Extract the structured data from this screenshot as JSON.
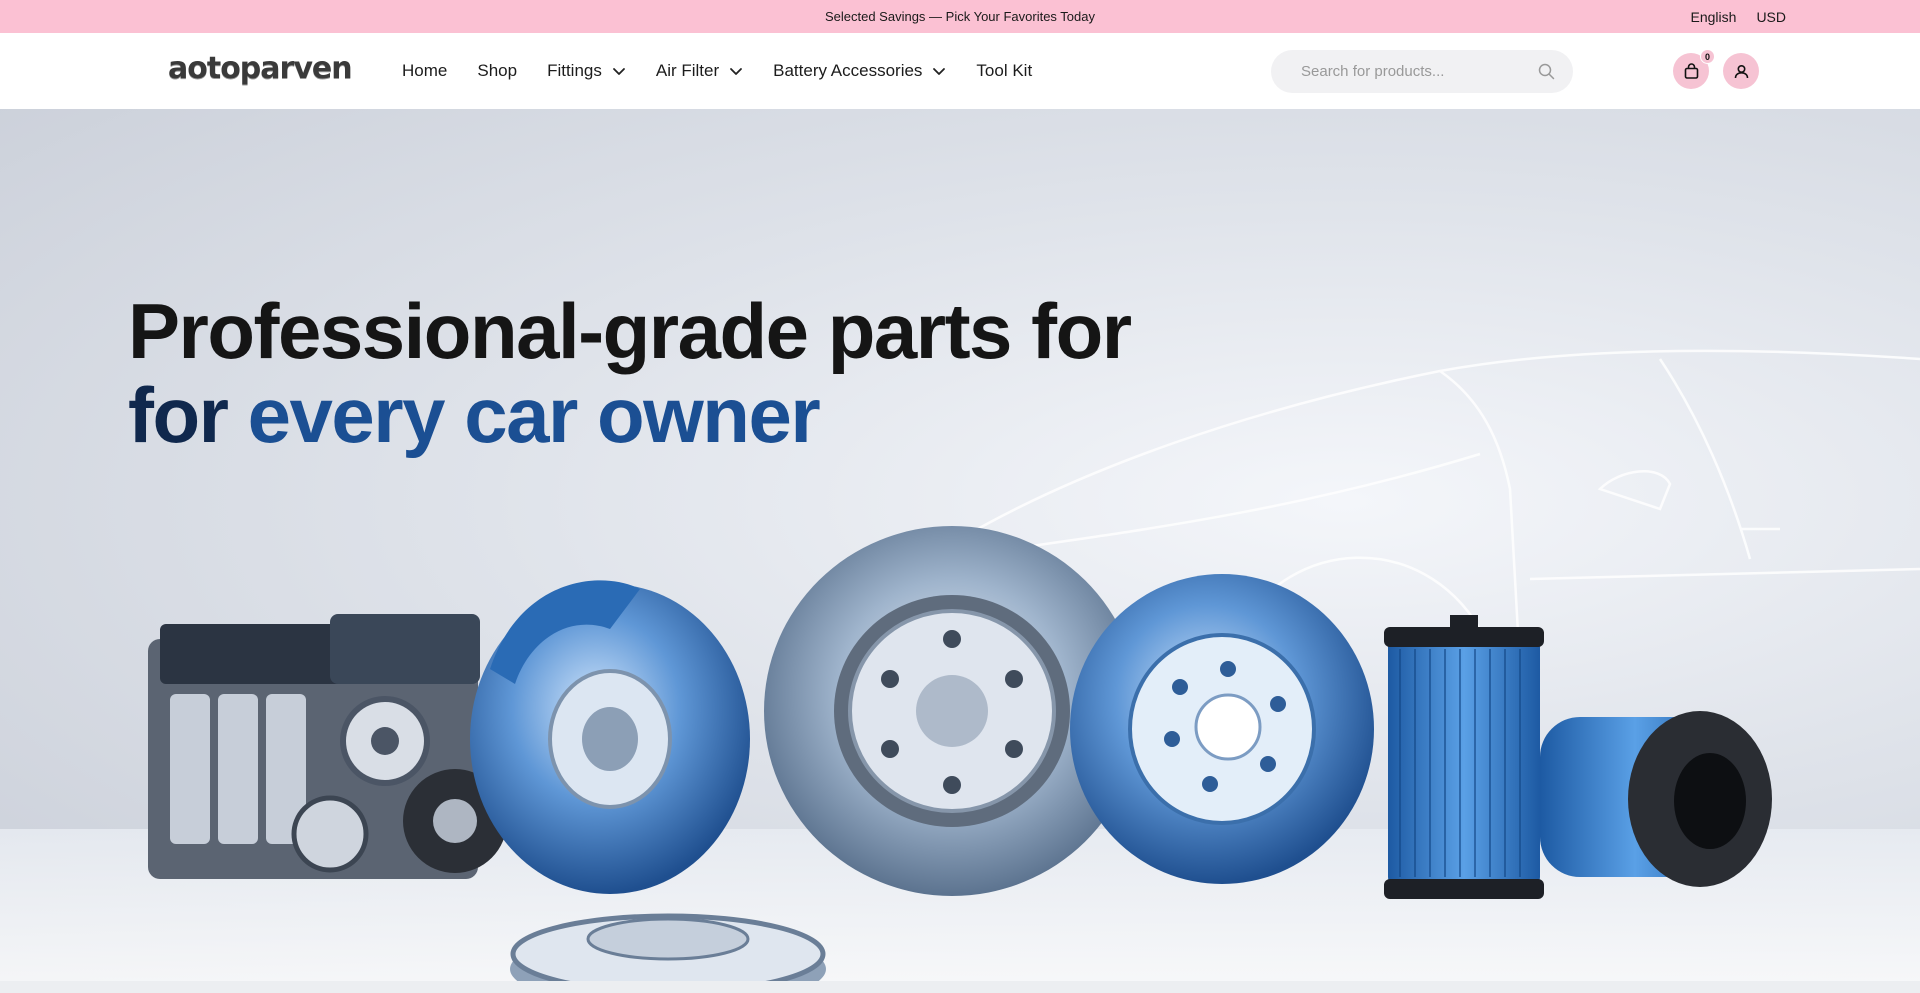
{
  "topbar": {
    "promo": "Selected Savings — Pick Your Favorites Today",
    "language": "English",
    "currency": "USD",
    "bg_color": "#fbc1d3"
  },
  "header": {
    "logo_text": "aotoparven",
    "nav": [
      {
        "label": "Home",
        "has_dropdown": false
      },
      {
        "label": "Shop",
        "has_dropdown": false
      },
      {
        "label": "Fittings",
        "has_dropdown": true
      },
      {
        "label": "Air Filter",
        "has_dropdown": true
      },
      {
        "label": "Battery Accessories",
        "has_dropdown": true
      },
      {
        "label": "Tool Kit",
        "has_dropdown": false
      }
    ],
    "search_placeholder": "Search for products...",
    "cart_count": "0",
    "icons": {
      "search": "search-icon",
      "cart": "shopping-bag-icon",
      "account": "user-icon",
      "dropdown": "chevron-down-icon"
    }
  },
  "hero": {
    "line1": "Professional-grade parts for",
    "line2_dark": "for",
    "line2_blue": "every car owner",
    "colors": {
      "dark": "#10284d",
      "blue": "#1b4f93"
    }
  }
}
